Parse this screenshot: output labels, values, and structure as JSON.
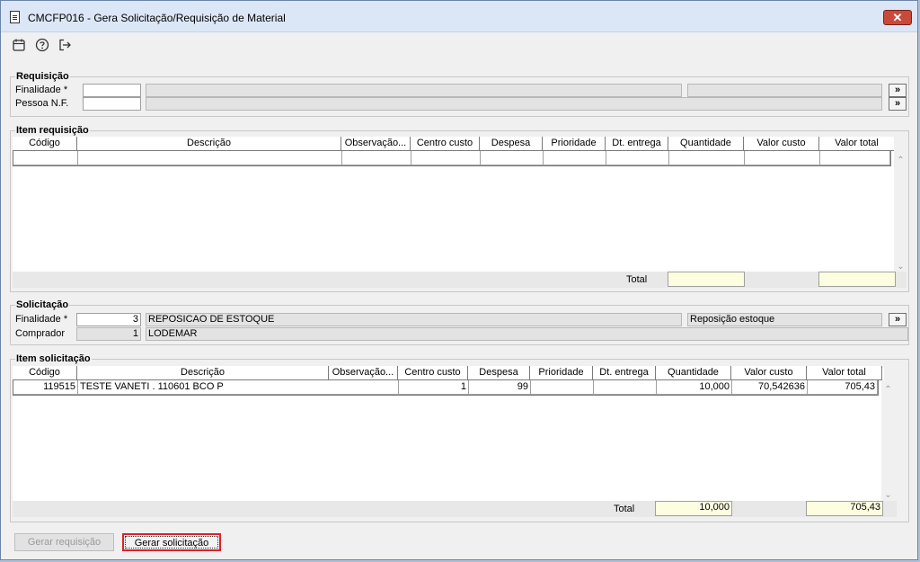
{
  "window": {
    "title": "CMCFP016 - Gera Solicitação/Requisição de Material",
    "close_label": "✕"
  },
  "toolbar": {
    "icons": [
      "calendar-icon",
      "help-icon",
      "exit-icon"
    ]
  },
  "requisicao": {
    "title": "Requisição",
    "finalidade_label": "Finalidade *",
    "pessoa_label": "Pessoa N.F.",
    "more_label": "»"
  },
  "item_requisicao": {
    "title": "Item requisição",
    "columns": [
      "Código",
      "Descrição",
      "Observação...",
      "Centro custo",
      "Despesa",
      "Prioridade",
      "Dt. entrega",
      "Quantidade",
      "Valor custo",
      "Valor total"
    ],
    "total_label": "Total",
    "total_quantidade": "",
    "total_valor": ""
  },
  "solicitacao": {
    "title": "Solicitação",
    "finalidade_label": "Finalidade *",
    "finalidade_code": "3",
    "finalidade_desc": "REPOSICAO DE ESTOQUE",
    "finalidade_extra": "Reposição estoque",
    "comprador_label": "Comprador",
    "comprador_code": "1",
    "comprador_name": "LODEMAR",
    "more_label": "»"
  },
  "item_solicitacao": {
    "title": "Item solicitação",
    "columns": [
      "Código",
      "Descrição",
      "Observação...",
      "Centro custo",
      "Despesa",
      "Prioridade",
      "Dt. entrega",
      "Quantidade",
      "Valor custo",
      "Valor total"
    ],
    "rows": [
      {
        "codigo": "119515",
        "descricao": "TESTE VANETI . 110601 BCO P",
        "observacao": "",
        "centro_custo": "1",
        "despesa": "99",
        "prioridade": "",
        "dt_entrega": "",
        "quantidade": "10,000",
        "valor_custo": "70,542636",
        "valor_total": "705,43"
      }
    ],
    "total_label": "Total",
    "total_quantidade": "10,000",
    "total_valor": "705,43"
  },
  "buttons": {
    "gerar_requisicao": "Gerar requisição",
    "gerar_solicitacao": "Gerar solicitação"
  },
  "colors": {
    "titlebar": "#dbe7f6",
    "close": "#c94a3b",
    "highlight_border": "#e0202a",
    "total_field": "#fdfde0"
  }
}
